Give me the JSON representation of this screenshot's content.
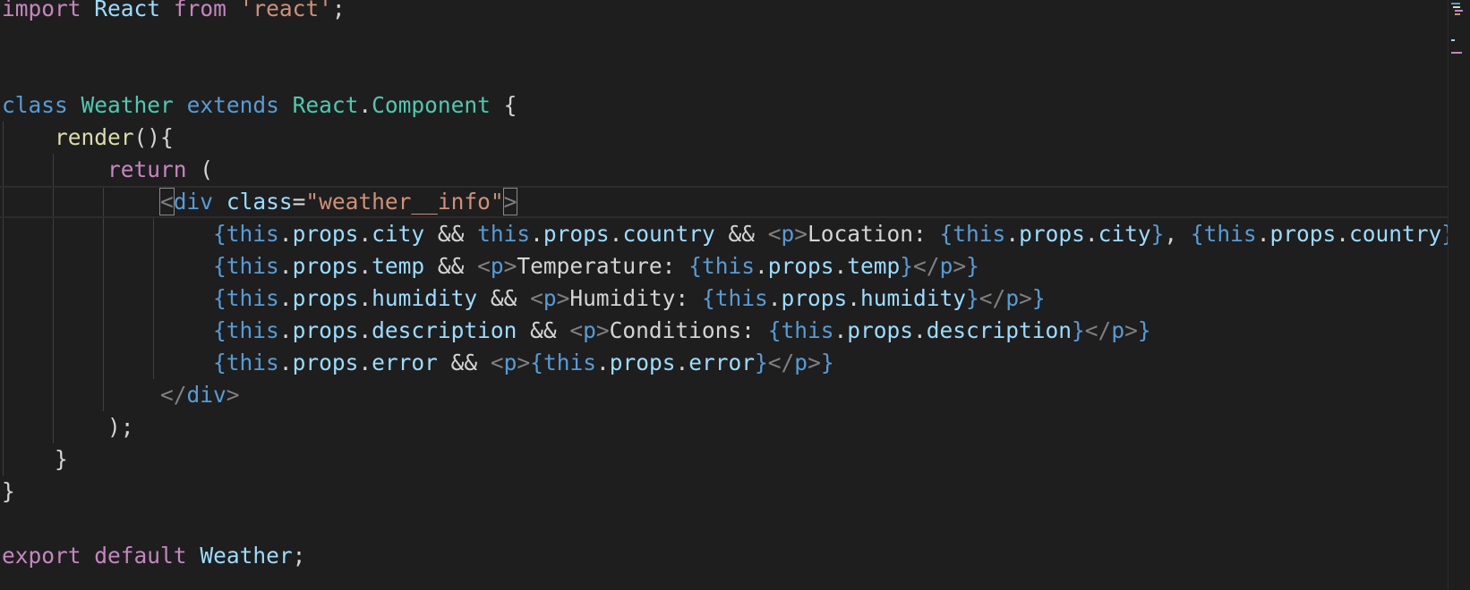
{
  "editor": {
    "language": "javascript-jsx",
    "theme_colors": {
      "background": "#1e1e1e",
      "keyword": "#569cd6",
      "control_keyword": "#c586c0",
      "class_name": "#4ec9b0",
      "function": "#dcdcaa",
      "variable": "#9cdcfe",
      "string": "#ce9178",
      "tag": "#569cd6",
      "punctuation": "#808080",
      "text": "#d4d4d4"
    },
    "active_line": 6,
    "lines": [
      {
        "guides": 0,
        "tokens": [
          [
            "import",
            "#c586c0"
          ],
          [
            " ",
            "#d4d4d4"
          ],
          [
            "React",
            "#9cdcfe"
          ],
          [
            " ",
            "#d4d4d4"
          ],
          [
            "from",
            "#c586c0"
          ],
          [
            " ",
            "#d4d4d4"
          ],
          [
            "'react'",
            "#ce9178"
          ],
          [
            ";",
            "#d4d4d4"
          ]
        ]
      },
      {
        "guides": 0,
        "tokens": []
      },
      {
        "guides": 0,
        "tokens": []
      },
      {
        "guides": 0,
        "tokens": [
          [
            "class",
            "#569cd6"
          ],
          [
            " ",
            "#d4d4d4"
          ],
          [
            "Weather",
            "#4ec9b0"
          ],
          [
            " ",
            "#d4d4d4"
          ],
          [
            "extends",
            "#569cd6"
          ],
          [
            " ",
            "#d4d4d4"
          ],
          [
            "React",
            "#4ec9b0"
          ],
          [
            ".",
            "#d4d4d4"
          ],
          [
            "Component",
            "#4ec9b0"
          ],
          [
            " {",
            "#d4d4d4"
          ]
        ]
      },
      {
        "guides": 1,
        "tokens": [
          [
            "    ",
            "#d4d4d4"
          ],
          [
            "render",
            "#dcdcaa"
          ],
          [
            "(){",
            "#d4d4d4"
          ]
        ]
      },
      {
        "guides": 2,
        "tokens": [
          [
            "        ",
            "#d4d4d4"
          ],
          [
            "return",
            "#c586c0"
          ],
          [
            " (",
            "#d4d4d4"
          ]
        ]
      },
      {
        "guides": 3,
        "tokens": [
          [
            "            ",
            "#d4d4d4"
          ],
          [
            "<",
            "#808080",
            "box"
          ],
          [
            "div",
            "#569cd6"
          ],
          [
            " ",
            "#d4d4d4"
          ],
          [
            "class",
            "#9cdcfe"
          ],
          [
            "=",
            "#d4d4d4"
          ],
          [
            "\"weather__info\"",
            "#ce9178"
          ],
          [
            ">",
            "#808080",
            "box"
          ]
        ]
      },
      {
        "guides": 4,
        "tokens": [
          [
            "                ",
            "#d4d4d4"
          ],
          [
            "{",
            "#569cd6"
          ],
          [
            "this",
            "#569cd6"
          ],
          [
            ".",
            "#d4d4d4"
          ],
          [
            "props",
            "#9cdcfe"
          ],
          [
            ".",
            "#d4d4d4"
          ],
          [
            "city",
            "#9cdcfe"
          ],
          [
            " && ",
            "#d4d4d4"
          ],
          [
            "this",
            "#569cd6"
          ],
          [
            ".",
            "#d4d4d4"
          ],
          [
            "props",
            "#9cdcfe"
          ],
          [
            ".",
            "#d4d4d4"
          ],
          [
            "country",
            "#9cdcfe"
          ],
          [
            " && ",
            "#d4d4d4"
          ],
          [
            "<",
            "#808080"
          ],
          [
            "p",
            "#569cd6"
          ],
          [
            ">",
            "#808080"
          ],
          [
            "Location: ",
            "#d4d4d4"
          ],
          [
            "{",
            "#569cd6"
          ],
          [
            "this",
            "#569cd6"
          ],
          [
            ".",
            "#d4d4d4"
          ],
          [
            "props",
            "#9cdcfe"
          ],
          [
            ".",
            "#d4d4d4"
          ],
          [
            "city",
            "#9cdcfe"
          ],
          [
            "}",
            "#569cd6"
          ],
          [
            ", ",
            "#d4d4d4"
          ],
          [
            "{",
            "#569cd6"
          ],
          [
            "this",
            "#569cd6"
          ],
          [
            ".",
            "#d4d4d4"
          ],
          [
            "props",
            "#9cdcfe"
          ],
          [
            ".",
            "#d4d4d4"
          ],
          [
            "country",
            "#9cdcfe"
          ],
          [
            "}",
            "#569cd6"
          ],
          [
            "</",
            "#808080"
          ]
        ]
      },
      {
        "guides": 4,
        "tokens": [
          [
            "                ",
            "#d4d4d4"
          ],
          [
            "{",
            "#569cd6"
          ],
          [
            "this",
            "#569cd6"
          ],
          [
            ".",
            "#d4d4d4"
          ],
          [
            "props",
            "#9cdcfe"
          ],
          [
            ".",
            "#d4d4d4"
          ],
          [
            "temp",
            "#9cdcfe"
          ],
          [
            " && ",
            "#d4d4d4"
          ],
          [
            "<",
            "#808080"
          ],
          [
            "p",
            "#569cd6"
          ],
          [
            ">",
            "#808080"
          ],
          [
            "Temperature: ",
            "#d4d4d4"
          ],
          [
            "{",
            "#569cd6"
          ],
          [
            "this",
            "#569cd6"
          ],
          [
            ".",
            "#d4d4d4"
          ],
          [
            "props",
            "#9cdcfe"
          ],
          [
            ".",
            "#d4d4d4"
          ],
          [
            "temp",
            "#9cdcfe"
          ],
          [
            "}",
            "#569cd6"
          ],
          [
            "</",
            "#808080"
          ],
          [
            "p",
            "#569cd6"
          ],
          [
            ">",
            "#808080"
          ],
          [
            "}",
            "#569cd6"
          ]
        ]
      },
      {
        "guides": 4,
        "tokens": [
          [
            "                ",
            "#d4d4d4"
          ],
          [
            "{",
            "#569cd6"
          ],
          [
            "this",
            "#569cd6"
          ],
          [
            ".",
            "#d4d4d4"
          ],
          [
            "props",
            "#9cdcfe"
          ],
          [
            ".",
            "#d4d4d4"
          ],
          [
            "humidity",
            "#9cdcfe"
          ],
          [
            " && ",
            "#d4d4d4"
          ],
          [
            "<",
            "#808080"
          ],
          [
            "p",
            "#569cd6"
          ],
          [
            ">",
            "#808080"
          ],
          [
            "Humidity: ",
            "#d4d4d4"
          ],
          [
            "{",
            "#569cd6"
          ],
          [
            "this",
            "#569cd6"
          ],
          [
            ".",
            "#d4d4d4"
          ],
          [
            "props",
            "#9cdcfe"
          ],
          [
            ".",
            "#d4d4d4"
          ],
          [
            "humidity",
            "#9cdcfe"
          ],
          [
            "}",
            "#569cd6"
          ],
          [
            "</",
            "#808080"
          ],
          [
            "p",
            "#569cd6"
          ],
          [
            ">",
            "#808080"
          ],
          [
            "}",
            "#569cd6"
          ]
        ]
      },
      {
        "guides": 4,
        "tokens": [
          [
            "                ",
            "#d4d4d4"
          ],
          [
            "{",
            "#569cd6"
          ],
          [
            "this",
            "#569cd6"
          ],
          [
            ".",
            "#d4d4d4"
          ],
          [
            "props",
            "#9cdcfe"
          ],
          [
            ".",
            "#d4d4d4"
          ],
          [
            "description",
            "#9cdcfe"
          ],
          [
            " && ",
            "#d4d4d4"
          ],
          [
            "<",
            "#808080"
          ],
          [
            "p",
            "#569cd6"
          ],
          [
            ">",
            "#808080"
          ],
          [
            "Conditions: ",
            "#d4d4d4"
          ],
          [
            "{",
            "#569cd6"
          ],
          [
            "this",
            "#569cd6"
          ],
          [
            ".",
            "#d4d4d4"
          ],
          [
            "props",
            "#9cdcfe"
          ],
          [
            ".",
            "#d4d4d4"
          ],
          [
            "description",
            "#9cdcfe"
          ],
          [
            "}",
            "#569cd6"
          ],
          [
            "</",
            "#808080"
          ],
          [
            "p",
            "#569cd6"
          ],
          [
            ">",
            "#808080"
          ],
          [
            "}",
            "#569cd6"
          ]
        ]
      },
      {
        "guides": 4,
        "tokens": [
          [
            "                ",
            "#d4d4d4"
          ],
          [
            "{",
            "#569cd6"
          ],
          [
            "this",
            "#569cd6"
          ],
          [
            ".",
            "#d4d4d4"
          ],
          [
            "props",
            "#9cdcfe"
          ],
          [
            ".",
            "#d4d4d4"
          ],
          [
            "error",
            "#9cdcfe"
          ],
          [
            " && ",
            "#d4d4d4"
          ],
          [
            "<",
            "#808080"
          ],
          [
            "p",
            "#569cd6"
          ],
          [
            ">",
            "#808080"
          ],
          [
            "{",
            "#569cd6"
          ],
          [
            "this",
            "#569cd6"
          ],
          [
            ".",
            "#d4d4d4"
          ],
          [
            "props",
            "#9cdcfe"
          ],
          [
            ".",
            "#d4d4d4"
          ],
          [
            "error",
            "#9cdcfe"
          ],
          [
            "}",
            "#569cd6"
          ],
          [
            "</",
            "#808080"
          ],
          [
            "p",
            "#569cd6"
          ],
          [
            ">",
            "#808080"
          ],
          [
            "}",
            "#569cd6"
          ]
        ]
      },
      {
        "guides": 3,
        "tokens": [
          [
            "            ",
            "#d4d4d4"
          ],
          [
            "</",
            "#808080"
          ],
          [
            "div",
            "#569cd6"
          ],
          [
            ">",
            "#808080"
          ]
        ]
      },
      {
        "guides": 2,
        "tokens": [
          [
            "        ",
            "#d4d4d4"
          ],
          [
            ");",
            "#d4d4d4"
          ]
        ]
      },
      {
        "guides": 1,
        "tokens": [
          [
            "    ",
            "#d4d4d4"
          ],
          [
            "}",
            "#d4d4d4"
          ]
        ]
      },
      {
        "guides": 0,
        "tokens": [
          [
            "}",
            "#d4d4d4"
          ]
        ]
      },
      {
        "guides": 0,
        "tokens": []
      },
      {
        "guides": 0,
        "tokens": [
          [
            "export",
            "#c586c0"
          ],
          [
            " ",
            "#d4d4d4"
          ],
          [
            "default",
            "#c586c0"
          ],
          [
            " ",
            "#d4d4d4"
          ],
          [
            "Weather",
            "#9cdcfe"
          ],
          [
            ";",
            "#d4d4d4"
          ]
        ]
      }
    ]
  }
}
